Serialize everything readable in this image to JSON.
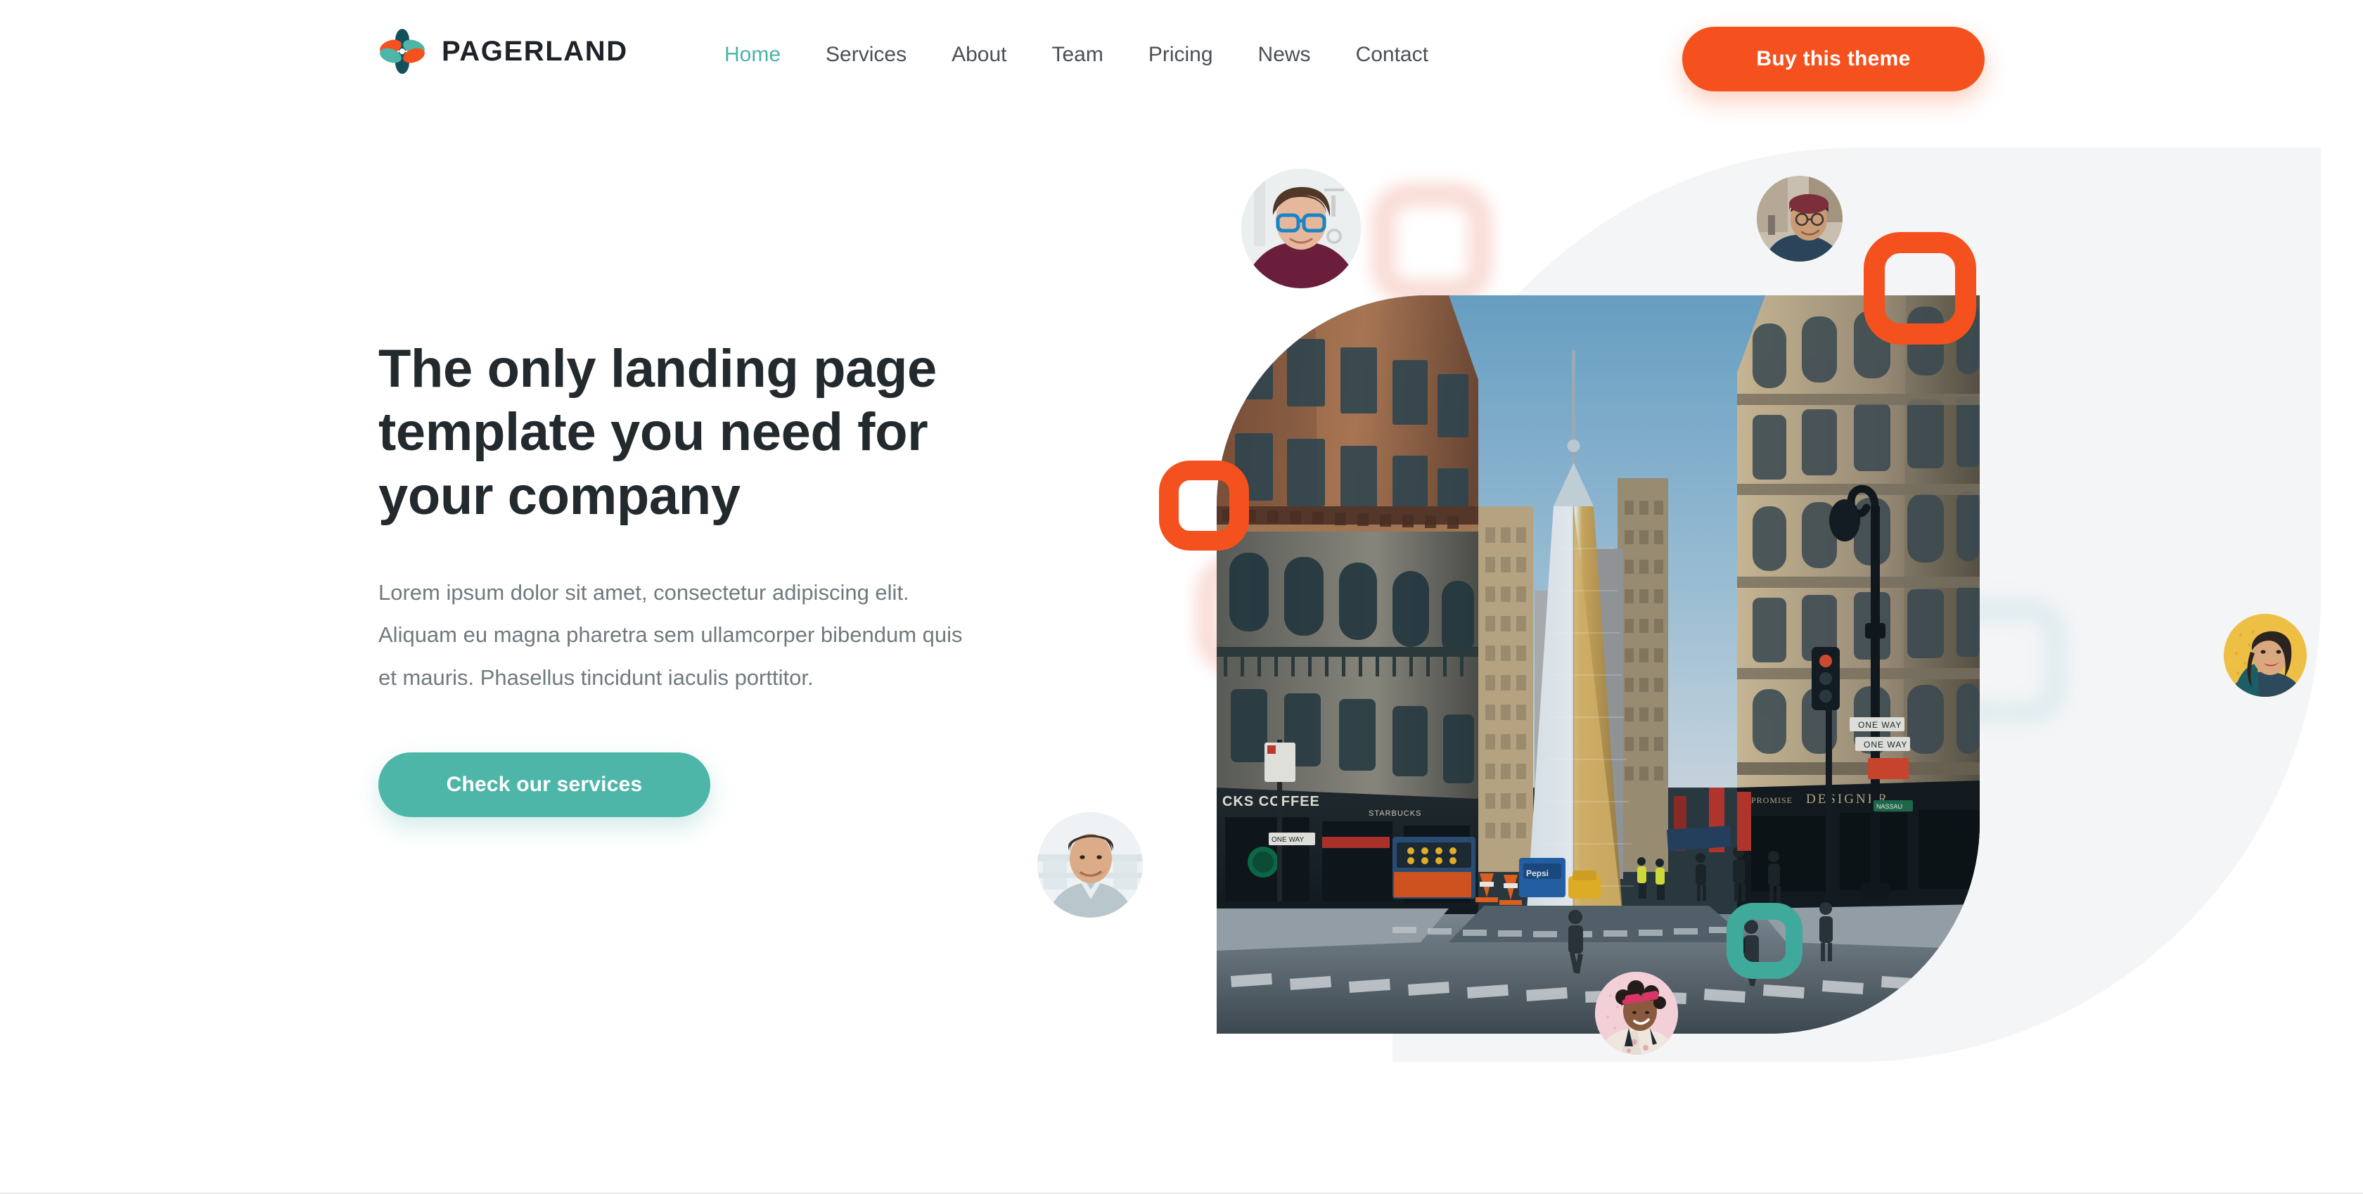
{
  "brand": {
    "name": "PAGERLAND",
    "logo_icon": "flower-logo-icon",
    "logo_colors": {
      "dark_teal": "#14505C",
      "teal": "#4DB6A8",
      "orange": "#F4511E"
    }
  },
  "nav": {
    "items": [
      {
        "label": "Home",
        "active": true
      },
      {
        "label": "Services",
        "active": false
      },
      {
        "label": "About",
        "active": false
      },
      {
        "label": "Team",
        "active": false
      },
      {
        "label": "Pricing",
        "active": false
      },
      {
        "label": "News",
        "active": false
      },
      {
        "label": "Contact",
        "active": false
      }
    ],
    "active_color": "#4CB3A6",
    "inactive_color": "#4A5055"
  },
  "header": {
    "buy_button_label": "Buy this theme",
    "buy_button_color": "#F4511E"
  },
  "hero": {
    "title": "The only landing page template you need for your company",
    "paragraph": "Lorem ipsum dolor sit amet, consectetur adipiscing elit. Aliquam eu magna pharetra sem ullamcorper bibendum quis et mauris. Phasellus tincidunt iaculis porttitor.",
    "cta_label": "Check our services",
    "cta_color": "#4DB6A8",
    "title_color": "#232A2E",
    "paragraph_color": "#707A7E"
  },
  "visual": {
    "photo_alt": "city-street-skyscraper-photo",
    "blob_color": "#F4F5F6",
    "decorations": [
      {
        "name": "orange-rounded-square-top-right",
        "color": "#F4511E"
      },
      {
        "name": "orange-rounded-square-left",
        "color": "#F4511E"
      },
      {
        "name": "teal-rounded-square-bottom",
        "color": "#3FA99C"
      },
      {
        "name": "blurred-pink-square-upper",
        "color": "#F4B9AD"
      },
      {
        "name": "blurred-pink-square-lower-left",
        "color": "#F4BCB0"
      },
      {
        "name": "blurred-blue-square-right",
        "color": "#CFE3EA"
      }
    ],
    "avatars": [
      {
        "name": "avatar-person-glasses",
        "position": "top-left"
      },
      {
        "name": "avatar-person-beanie",
        "position": "top-middle"
      },
      {
        "name": "avatar-woman-yellow-bg",
        "position": "right"
      },
      {
        "name": "avatar-man-grey-shirt",
        "position": "left-lower"
      },
      {
        "name": "avatar-woman-pink-bg",
        "position": "bottom-middle"
      }
    ]
  }
}
